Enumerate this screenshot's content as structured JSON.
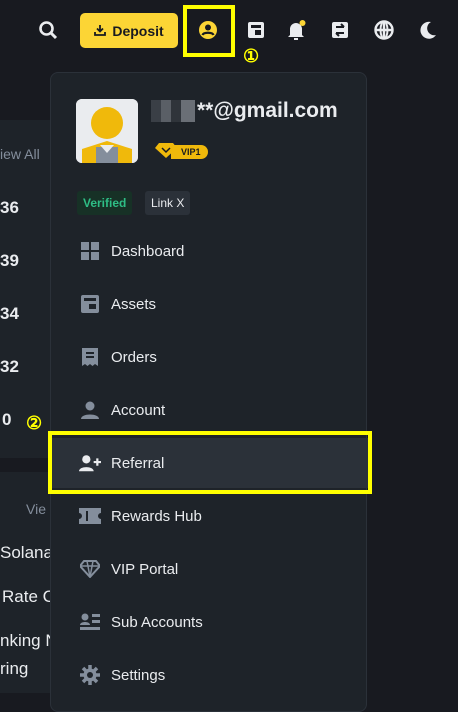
{
  "topbar": {
    "deposit_label": "Deposit",
    "icons": [
      "search-icon",
      "deposit-download-icon",
      "account-icon",
      "wallet-icon",
      "bell-icon",
      "transfer-icon",
      "globe-icon",
      "moon-icon"
    ],
    "annotation_1": "①"
  },
  "background": {
    "view_all": "iew All",
    "numbers": [
      "36",
      "39",
      "34",
      "32",
      "0"
    ],
    "view": "Vie",
    "lines": [
      "Solana",
      "Rate C",
      "nking N",
      "ring"
    ]
  },
  "menu": {
    "email": "**@gmail.com",
    "vip": "VIP1",
    "tags": [
      "Verified",
      "Link X"
    ],
    "items": [
      {
        "label": "Dashboard",
        "icon": "dashboard-icon"
      },
      {
        "label": "Assets",
        "icon": "wallet-icon"
      },
      {
        "label": "Orders",
        "icon": "orders-icon"
      },
      {
        "label": "Account",
        "icon": "account-icon"
      },
      {
        "label": "Referral",
        "icon": "add-user-icon"
      },
      {
        "label": "Rewards Hub",
        "icon": "ticket-icon"
      },
      {
        "label": "VIP Portal",
        "icon": "diamond-icon"
      },
      {
        "label": "Sub Accounts",
        "icon": "sub-accounts-icon"
      },
      {
        "label": "Settings",
        "icon": "gear-icon"
      }
    ],
    "annotation_2": "②"
  },
  "colors": {
    "accent": "#fcd535",
    "highlight": "#ffff00",
    "verified": "#2ebd85",
    "panel": "#1e2329",
    "bg": "#181a20"
  }
}
